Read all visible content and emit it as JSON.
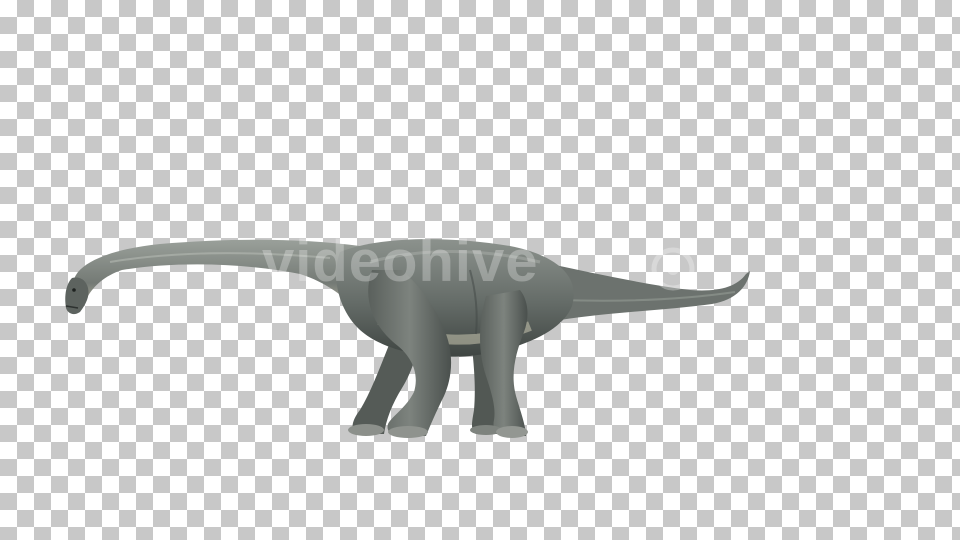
{
  "canvas": {
    "pattern": "transparency-checkerboard",
    "colors": {
      "light": "#ffffff",
      "dark": "#c8c8c8"
    }
  },
  "subject": {
    "icon": "sauropod-dinosaur",
    "colors": {
      "body": "#6f7672",
      "shadow": "#454b48",
      "belly": "#c9c6b1",
      "highlight": "#a3a8a3"
    }
  },
  "watermark": {
    "text": "videohive",
    "icon": "videohive-logo-mark"
  }
}
